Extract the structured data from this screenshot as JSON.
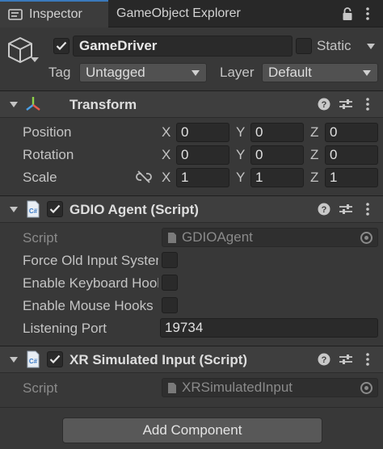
{
  "tabs": [
    {
      "label": "Inspector",
      "active": true
    },
    {
      "label": "GameObject Explorer",
      "active": false
    }
  ],
  "header": {
    "object_name": "GameDriver",
    "active": true,
    "static_label": "Static",
    "static_checked": false,
    "tag_label": "Tag",
    "tag_value": "Untagged",
    "layer_label": "Layer",
    "layer_value": "Default"
  },
  "transform": {
    "title": "Transform",
    "rows": [
      {
        "label": "Position",
        "x": "0",
        "y": "0",
        "z": "0"
      },
      {
        "label": "Rotation",
        "x": "0",
        "y": "0",
        "z": "0"
      },
      {
        "label": "Scale",
        "x": "1",
        "y": "1",
        "z": "1"
      }
    ],
    "axis_labels": {
      "x": "X",
      "y": "Y",
      "z": "Z"
    }
  },
  "gdio_agent": {
    "title": "GDIO Agent (Script)",
    "enabled": true,
    "script_label": "Script",
    "script_value": "GDIOAgent",
    "bools": [
      {
        "label": "Force Old Input System",
        "checked": false
      },
      {
        "label": "Enable Keyboard Hooks",
        "checked": false
      },
      {
        "label": "Enable Mouse Hooks",
        "checked": false
      }
    ],
    "port_label": "Listening Port",
    "port_value": "19734"
  },
  "xr_input": {
    "title": "XR Simulated Input (Script)",
    "enabled": true,
    "script_label": "Script",
    "script_value": "XRSimulatedInput"
  },
  "add_component_label": "Add Component",
  "colors": {
    "background": "#383838",
    "tab_accent": "#3a79bb",
    "field": "#2a2a2a"
  }
}
